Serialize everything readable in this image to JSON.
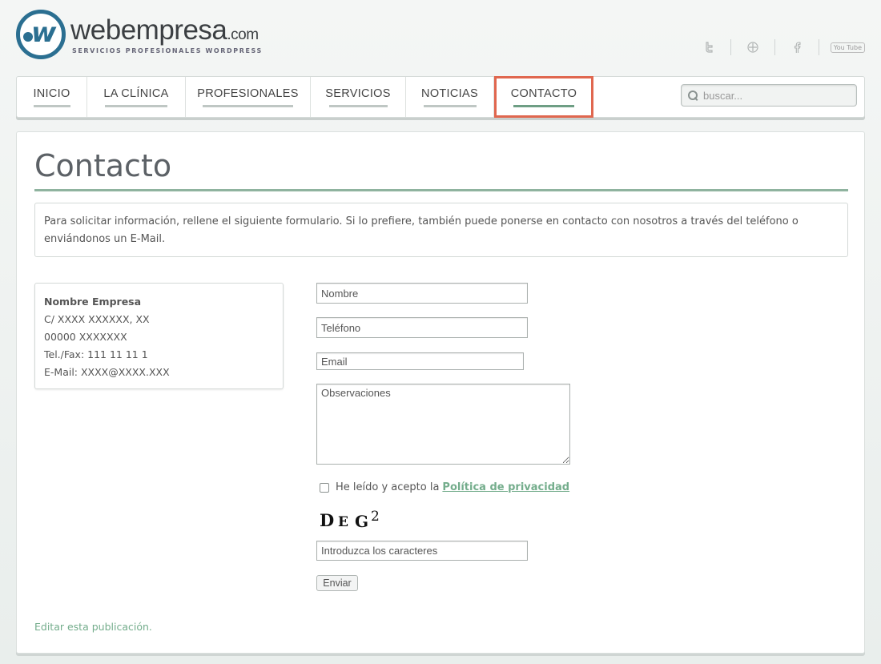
{
  "brand": {
    "name": "webempresa",
    "tld": ".com",
    "tagline": "SERVICIOS PROFESIONALES WORDPRESS",
    "color": "#2b6f91"
  },
  "social": {
    "items": [
      {
        "icon": "twitter-icon"
      },
      {
        "icon": "google-plus-icon"
      },
      {
        "icon": "facebook-icon"
      },
      {
        "icon": "youtube-icon",
        "label": "You Tube"
      }
    ]
  },
  "nav": {
    "items": [
      {
        "label": "INICIO"
      },
      {
        "label": "LA CLÍNICA"
      },
      {
        "label": "PROFESIONALES"
      },
      {
        "label": "SERVICIOS"
      },
      {
        "label": "NOTICIAS"
      },
      {
        "label": "CONTACTO",
        "active": true
      }
    ],
    "active_color": "#6e9e84",
    "highlight_color": "#e0674f"
  },
  "search": {
    "placeholder": "buscar..."
  },
  "page": {
    "title": "Contacto",
    "intro": "Para solicitar información, rellene el siguiente formulario. Si lo prefiere, también puede ponerse en contacto con nosotros a través del teléfono o enviándonos un E-Mail."
  },
  "address": {
    "name": "Nombre Empresa",
    "street": "C/ XXXX XXXXXX, XX",
    "city": "00000 XXXXXXX",
    "phone": "Tel./Fax: 111 11 11 1",
    "email": "E-Mail: XXXX@XXXX.XXX"
  },
  "form": {
    "name_placeholder": "Nombre",
    "phone_placeholder": "Teléfono",
    "email_placeholder": "Email",
    "notes_placeholder": "Observaciones",
    "privacy_text": "He leído y acepto la",
    "privacy_link": "Política de privacidad",
    "captcha": [
      "D",
      "E",
      "G",
      "2"
    ],
    "captcha_placeholder": "Introduzca los caracteres",
    "submit_label": "Enviar"
  },
  "footer": {
    "edit_link": "Editar esta publicación."
  },
  "colors": {
    "accent_green": "#74ad8c",
    "title_rule": "#8fb39f"
  }
}
